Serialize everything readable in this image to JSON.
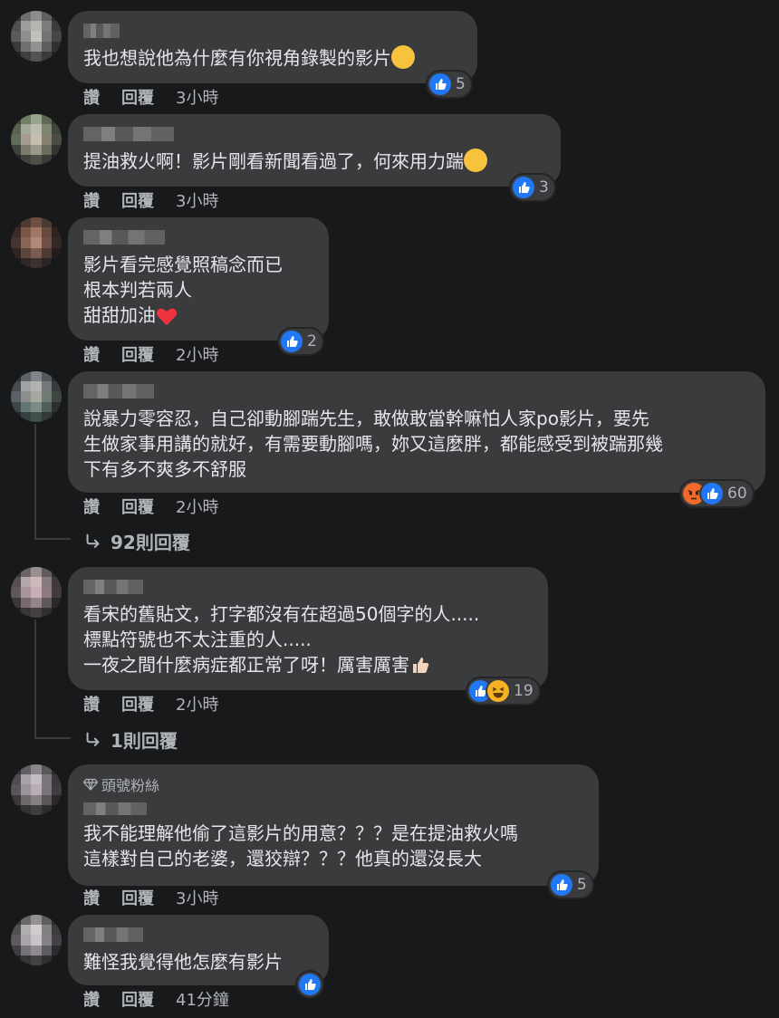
{
  "comments": [
    {
      "text": "我也想說他為什麼有你視角錄製的影片",
      "reaction_count": "5",
      "actions": {
        "like": "讚",
        "reply": "回覆",
        "time": "3小時"
      }
    },
    {
      "text": "提油救火啊！影片剛看新聞看過了，何來用力踹",
      "reaction_count": "3",
      "actions": {
        "like": "讚",
        "reply": "回覆",
        "time": "3小時"
      }
    },
    {
      "text": "影片看完感覺照稿念而已\n根本判若兩人\n甜甜加油",
      "reaction_count": "2",
      "actions": {
        "like": "讚",
        "reply": "回覆",
        "time": "2小時"
      }
    },
    {
      "text": "說暴力零容忍，自己卻動腳踹先生，敢做敢當幹嘛怕人家po影片，要先\n生做家事用講的就好，有需要動腳嗎，妳又這麼胖，都能感受到被踹那幾\n下有多不爽多不舒服",
      "reaction_count": "60",
      "actions": {
        "like": "讚",
        "reply": "回覆",
        "time": "2小時"
      },
      "replies_label": "92則回覆"
    },
    {
      "text": "看宋的舊貼文，打字都沒有在超過50個字的人.....\n標點符號也不太注重的人.....\n一夜之間什麼病症都正常了呀！厲害厲害",
      "reaction_count": "19",
      "actions": {
        "like": "讚",
        "reply": "回覆",
        "time": "2小時"
      },
      "replies_label": "1則回覆"
    },
    {
      "badge": "頭號粉絲",
      "text": "我不能理解他偷了這影片的用意？？？是在提油救火嗎\n這樣對自己的老婆，還狡辯？？？他真的還沒長大",
      "reaction_count": "5",
      "actions": {
        "like": "讚",
        "reply": "回覆",
        "time": "3小時"
      }
    },
    {
      "text": "難怪我覺得他怎麼有影片",
      "reaction_count": "",
      "actions": {
        "like": "讚",
        "reply": "回覆",
        "time": "41分鐘"
      }
    }
  ],
  "icons": {
    "like": "like-reaction-icon",
    "angry": "angry-reaction-icon",
    "haha": "haha-reaction-icon",
    "reply_arrow": "reply-arrow-icon",
    "badge": "diamond-icon"
  },
  "colors": {
    "background": "#18191a",
    "bubble": "#3a3b3c",
    "like_blue": "#2078f4",
    "secondary_text": "#b0b3b8"
  }
}
